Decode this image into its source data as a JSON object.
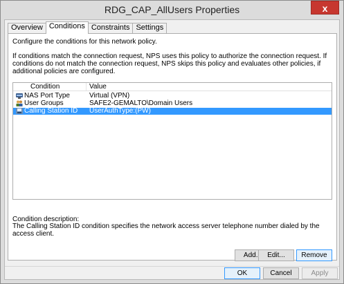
{
  "window": {
    "title": "RDG_CAP_AllUsers Properties",
    "close_glyph": "x"
  },
  "tabs": [
    {
      "label": "Overview",
      "active": false
    },
    {
      "label": "Conditions",
      "active": true
    },
    {
      "label": "Constraints",
      "active": false
    },
    {
      "label": "Settings",
      "active": false
    }
  ],
  "panel": {
    "intro": "Configure the conditions for this network policy.",
    "paragraph": "If conditions match the connection request, NPS uses this policy to authorize the connection request. If conditions do not match the connection request, NPS skips this policy and evaluates other policies, if additional policies are configured.",
    "list": {
      "headers": {
        "condition": "Condition",
        "value": "Value"
      },
      "rows": [
        {
          "icon": "nas-port-icon",
          "condition": "NAS Port Type",
          "value": "Virtual (VPN)",
          "selected": false
        },
        {
          "icon": "user-groups-icon",
          "condition": "User Groups",
          "value": "SAFE2-GEMALTO\\Domain Users",
          "selected": false
        },
        {
          "icon": "calling-station-icon",
          "condition": "Calling Station ID",
          "value": "UserAuthType:(PW)",
          "selected": true
        }
      ]
    },
    "description_label": "Condition description:",
    "description": "The Calling Station ID condition specifies the network access server telephone number dialed by the access client.",
    "buttons": {
      "add": "Add...",
      "edit": "Edit...",
      "remove": "Remove"
    }
  },
  "footer": {
    "ok": "OK",
    "cancel": "Cancel",
    "apply": "Apply"
  },
  "colors": {
    "selection": "#3399ff",
    "close": "#c7372f"
  }
}
